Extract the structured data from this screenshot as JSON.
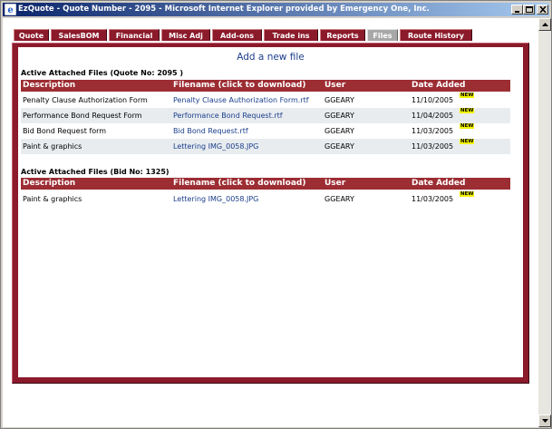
{
  "window": {
    "title": "EzQuote - Quote Number - 2095 - Microsoft Internet Explorer provided by Emergency One, Inc."
  },
  "tabs": [
    {
      "label": "Quote"
    },
    {
      "label": "SalesBOM"
    },
    {
      "label": "Financial"
    },
    {
      "label": "Misc Adj"
    },
    {
      "label": "Add-ons"
    },
    {
      "label": "Trade ins"
    },
    {
      "label": "Reports"
    },
    {
      "label": "Files",
      "active": true
    },
    {
      "label": "Route History"
    }
  ],
  "add_link": "Add a new file",
  "columns": {
    "description": "Description",
    "filename": "Filename (click to download)",
    "user": "User",
    "date": "Date Added"
  },
  "badge": "NEW",
  "quote_files": {
    "title": "Active Attached Files (Quote No: 2095 )",
    "rows": [
      {
        "description": "Penalty Clause Authorization Form",
        "filename": "Penalty Clause Authorization Form.rtf",
        "user": "GGEARY",
        "date": "11/10/2005"
      },
      {
        "description": "Performance Bond Request Form",
        "filename": "Performance Bond Request.rtf",
        "user": "GGEARY",
        "date": "11/04/2005"
      },
      {
        "description": "Bid Bond Request form",
        "filename": "Bid Bond Request.rtf",
        "user": "GGEARY",
        "date": "11/03/2005"
      },
      {
        "description": "Paint & graphics",
        "filename": "Lettering IMG_0058.JPG",
        "user": "GGEARY",
        "date": "11/03/2005"
      }
    ]
  },
  "bid_files": {
    "title": "Active Attached Files (Bid No: 1325)",
    "rows": [
      {
        "description": "Paint & graphics",
        "filename": "Lettering IMG_0058.JPG",
        "user": "GGEARY",
        "date": "11/03/2005"
      }
    ]
  }
}
